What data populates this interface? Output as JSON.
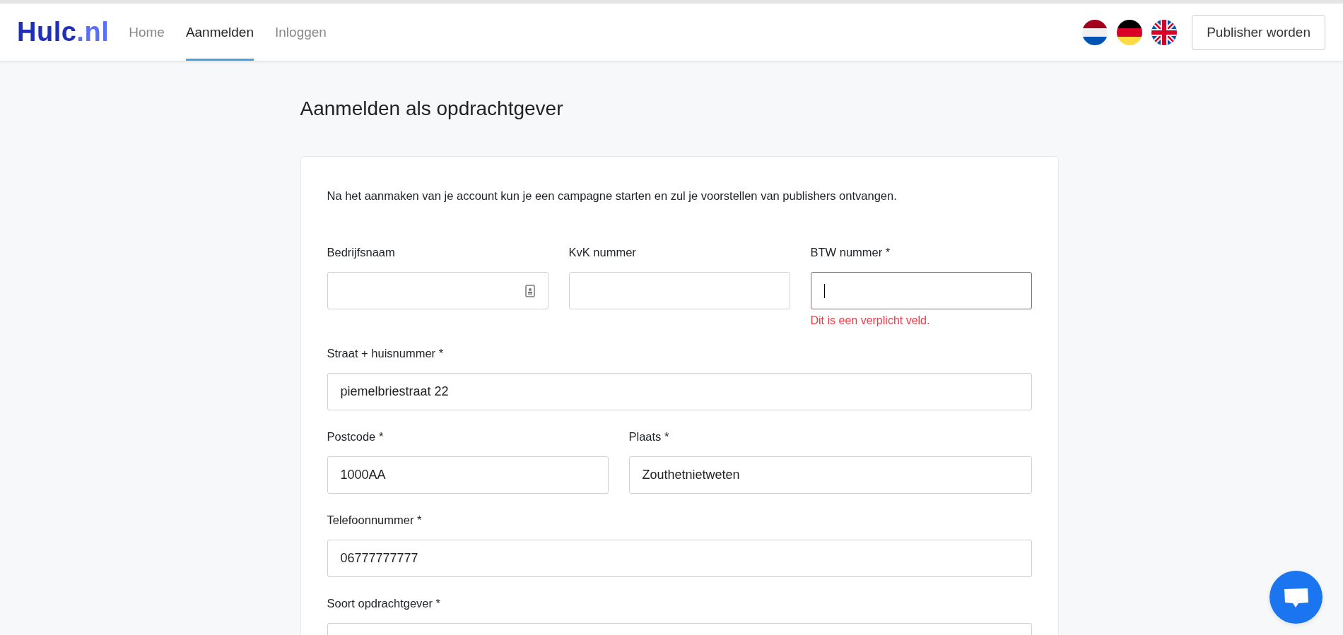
{
  "header": {
    "logo": {
      "main": "Hulc",
      "suffix": ".nl"
    },
    "nav": [
      {
        "label": "Home",
        "selected": false
      },
      {
        "label": "Aanmelden",
        "selected": true
      },
      {
        "label": "Inloggen",
        "selected": false
      }
    ],
    "languages": [
      {
        "kind": "nl"
      },
      {
        "kind": "de"
      },
      {
        "kind": "en"
      }
    ],
    "button": "Publisher worden"
  },
  "page_title": "Aanmelden als opdrachtgever",
  "card": {
    "intro": "Na het aanmaken van je account kun je een campagne starten en zul je voorstellen van publishers ontvangen.",
    "rows": [
      [
        {
          "label": "Bedrijfsnaam",
          "autofill_icon": true,
          "invalid": false,
          "focused": false
        },
        {
          "label": "KvK nummer",
          "autofill_icon": false,
          "invalid": false,
          "focused": false
        },
        {
          "label": "BTW nummer *",
          "autofill_icon": false,
          "invalid": true,
          "focused": true,
          "error": "Dit is een verplicht veld."
        }
      ],
      [
        {
          "label": "Straat + huisnummer *",
          "value": "piemelbriestraat 22",
          "autofill_icon": false,
          "invalid": false,
          "focused": false
        }
      ],
      [
        {
          "label": "Postcode *",
          "value": "1000AA",
          "autofill_icon": false,
          "invalid": false,
          "focused": false
        },
        {
          "label": "Plaats *",
          "value": "Zouthetnietweten",
          "autofill_icon": false,
          "invalid": false,
          "focused": false
        }
      ],
      [
        {
          "label": "Telefoonnummer *",
          "value": "06777777777",
          "autofill_icon": false,
          "invalid": false,
          "focused": false
        }
      ],
      [
        {
          "label": "Soort opdrachtgever *",
          "invalid": false
        }
      ]
    ]
  }
}
